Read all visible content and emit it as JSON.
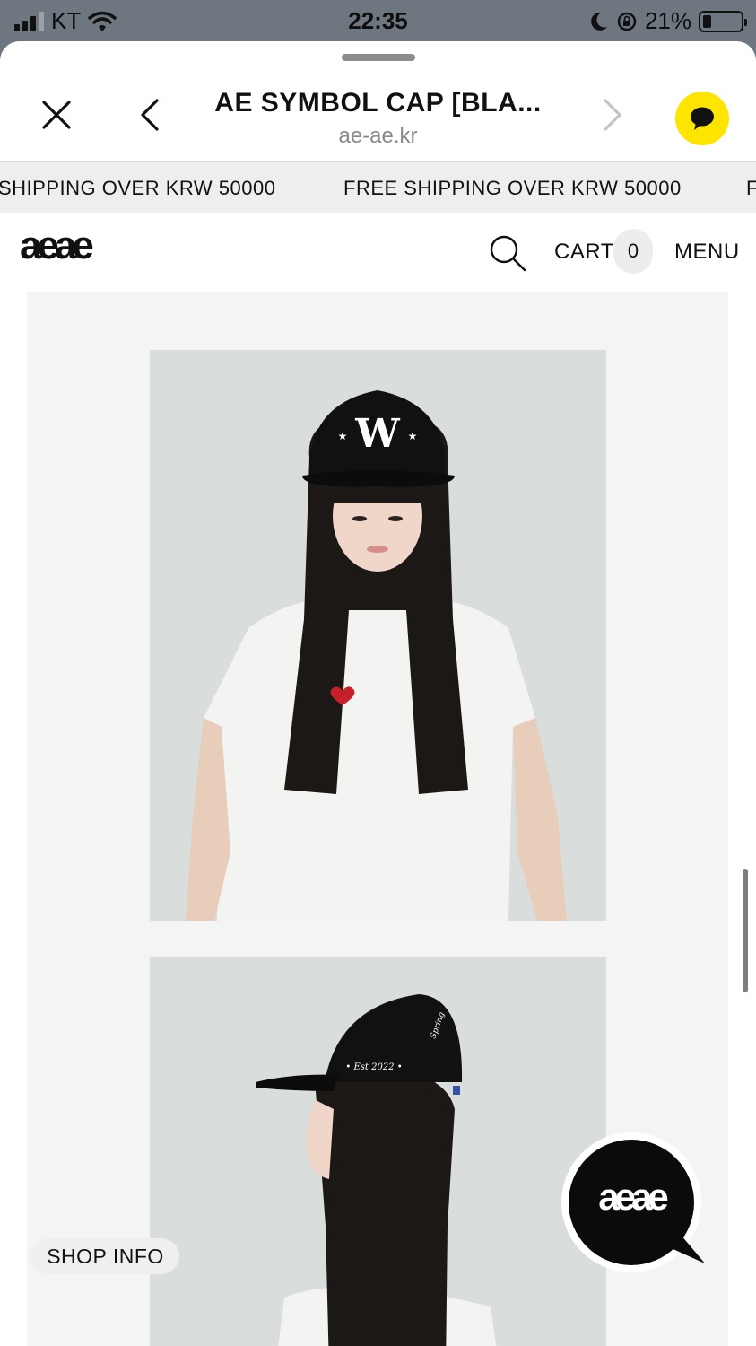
{
  "status_bar": {
    "carrier": "KT",
    "time": "22:35",
    "battery": "21%",
    "battery_level": 0.21
  },
  "browser": {
    "title": "AE SYMBOL CAP [BLA...",
    "url": "ae-ae.kr"
  },
  "marquee": {
    "items": [
      "SHIPPING OVER KRW 50000",
      "FREE SHIPPING OVER KRW 50000",
      "F"
    ]
  },
  "header": {
    "logo": "aeae",
    "cart_label": "CART",
    "cart_count": "0",
    "menu_label": "MENU"
  },
  "floating": {
    "shop_info": "SHOP INFO",
    "logo": "aeae"
  },
  "colors": {
    "kakao_yellow": "#fee500",
    "status_bar": "#6e7780",
    "marquee_bg": "#eeeeee",
    "content_bg": "#f4f4f4"
  },
  "icons": [
    "signal-icon",
    "wifi-icon",
    "moon-icon",
    "rotation-lock-icon",
    "battery-icon",
    "close-icon",
    "back-icon",
    "forward-icon",
    "kakao-chat-icon",
    "search-icon"
  ]
}
